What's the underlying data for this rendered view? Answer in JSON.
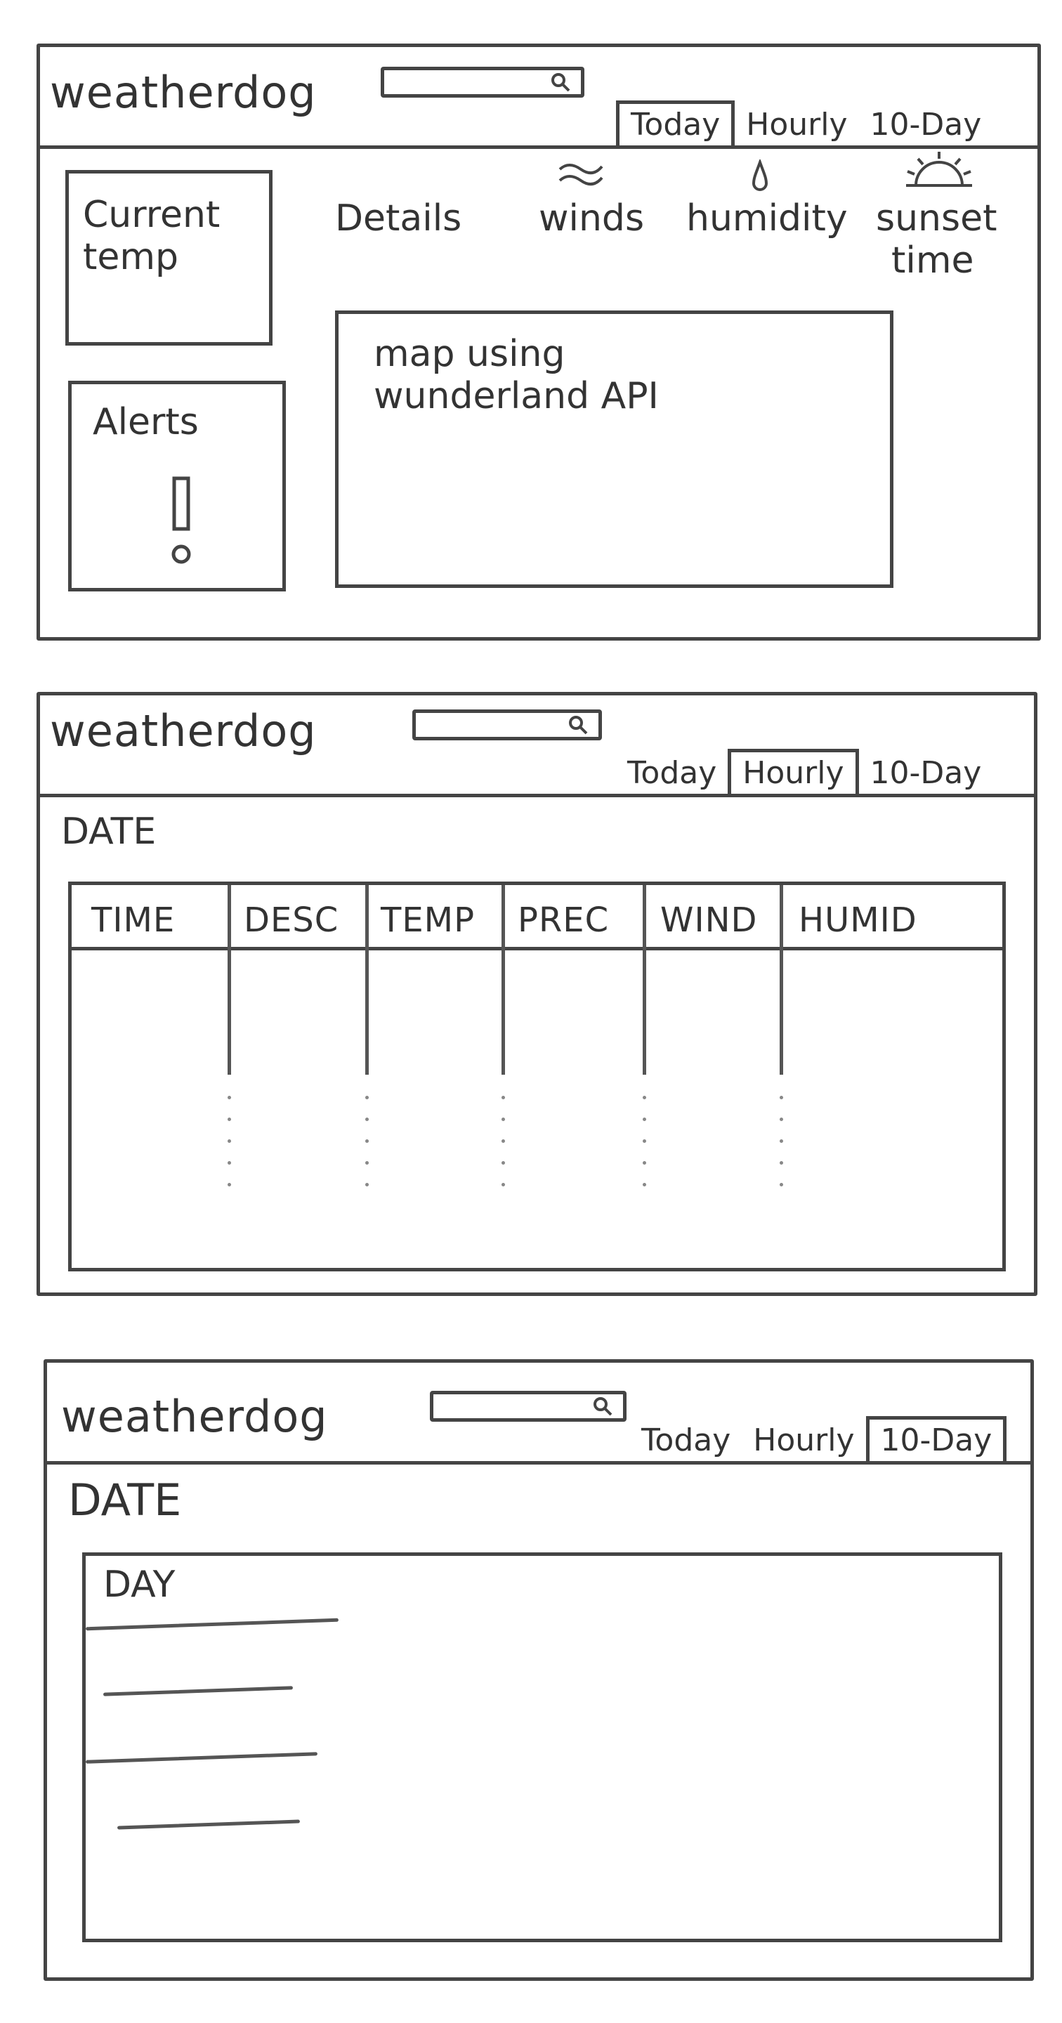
{
  "app": {
    "name": "weatherdog"
  },
  "tabs": [
    "Today",
    "Hourly",
    "10-Day"
  ],
  "today": {
    "current_temp": [
      "Current",
      "temp"
    ],
    "alerts": "Alerts",
    "details": "Details",
    "winds": "winds",
    "humidity": "humidity",
    "sunset": [
      "sunset",
      "time"
    ],
    "map": [
      "map using",
      "wunderland API"
    ]
  },
  "hourly": {
    "date": "DATE",
    "columns": [
      "TIME",
      "DESC",
      "TEMP",
      "PREC",
      "WIND",
      "HUMID"
    ]
  },
  "ten_day": {
    "date": "DATE",
    "day": "DAY"
  },
  "icons": [
    "search-icon",
    "wind-icon",
    "droplet-icon",
    "sunset-icon",
    "alert-icon"
  ]
}
